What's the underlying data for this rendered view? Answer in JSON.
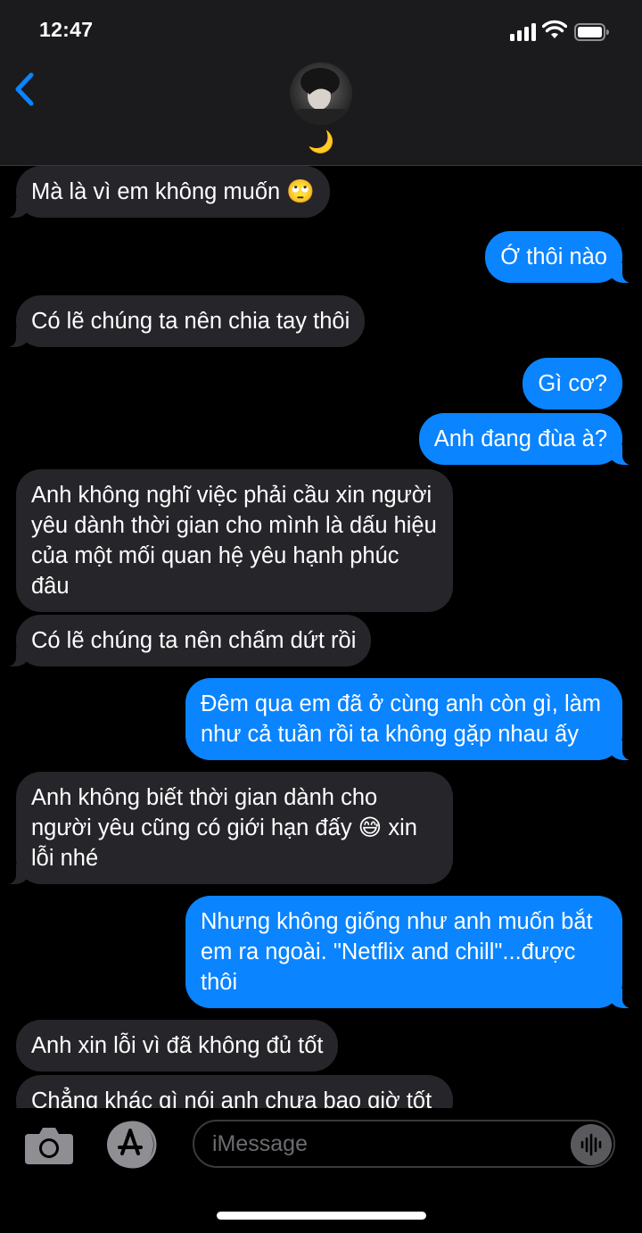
{
  "status_bar": {
    "time": "12:47"
  },
  "header": {
    "contact_name": "🌙",
    "avatar_icon": "profile-photo"
  },
  "messages": [
    {
      "from": "them",
      "text": "Mà là vì em không muốn 🙄"
    },
    {
      "from": "me",
      "text": "Ớ thôi nào"
    },
    {
      "from": "them",
      "text": "Có lẽ chúng ta nên chia tay thôi"
    },
    {
      "from": "me",
      "text": "Gì cơ?"
    },
    {
      "from": "me",
      "text": "Anh đang đùa à?"
    },
    {
      "from": "them",
      "text": "Anh không nghĩ việc phải cầu xin người yêu dành thời gian cho mình là dấu hiệu của một mối quan hệ yêu hạnh phúc đâu"
    },
    {
      "from": "them",
      "text": "Có lẽ chúng ta nên chấm dứt rồi"
    },
    {
      "from": "me",
      "text": "Đêm qua em đã ở cùng anh còn gì, làm như cả tuần rồi ta không gặp nhau ấy"
    },
    {
      "from": "them",
      "text": "Anh không biết thời gian dành cho người yêu cũng có giới hạn đấy 😅 xin lỗi nhé"
    },
    {
      "from": "me",
      "text": "Nhưng không giống như anh muốn bắt em ra ngoài. \"Netflix and chill\"...được thôi"
    },
    {
      "from": "them",
      "text": "Anh xin lỗi vì đã không đủ tốt"
    },
    {
      "from": "them",
      "text": "Chẳng khác gì nói anh chưa bao giờ tốt"
    }
  ],
  "input_bar": {
    "placeholder": "iMessage"
  },
  "colors": {
    "incoming_bubble": "#26252a",
    "outgoing_bubble": "#0a84ff",
    "accent": "#0a84ff"
  }
}
